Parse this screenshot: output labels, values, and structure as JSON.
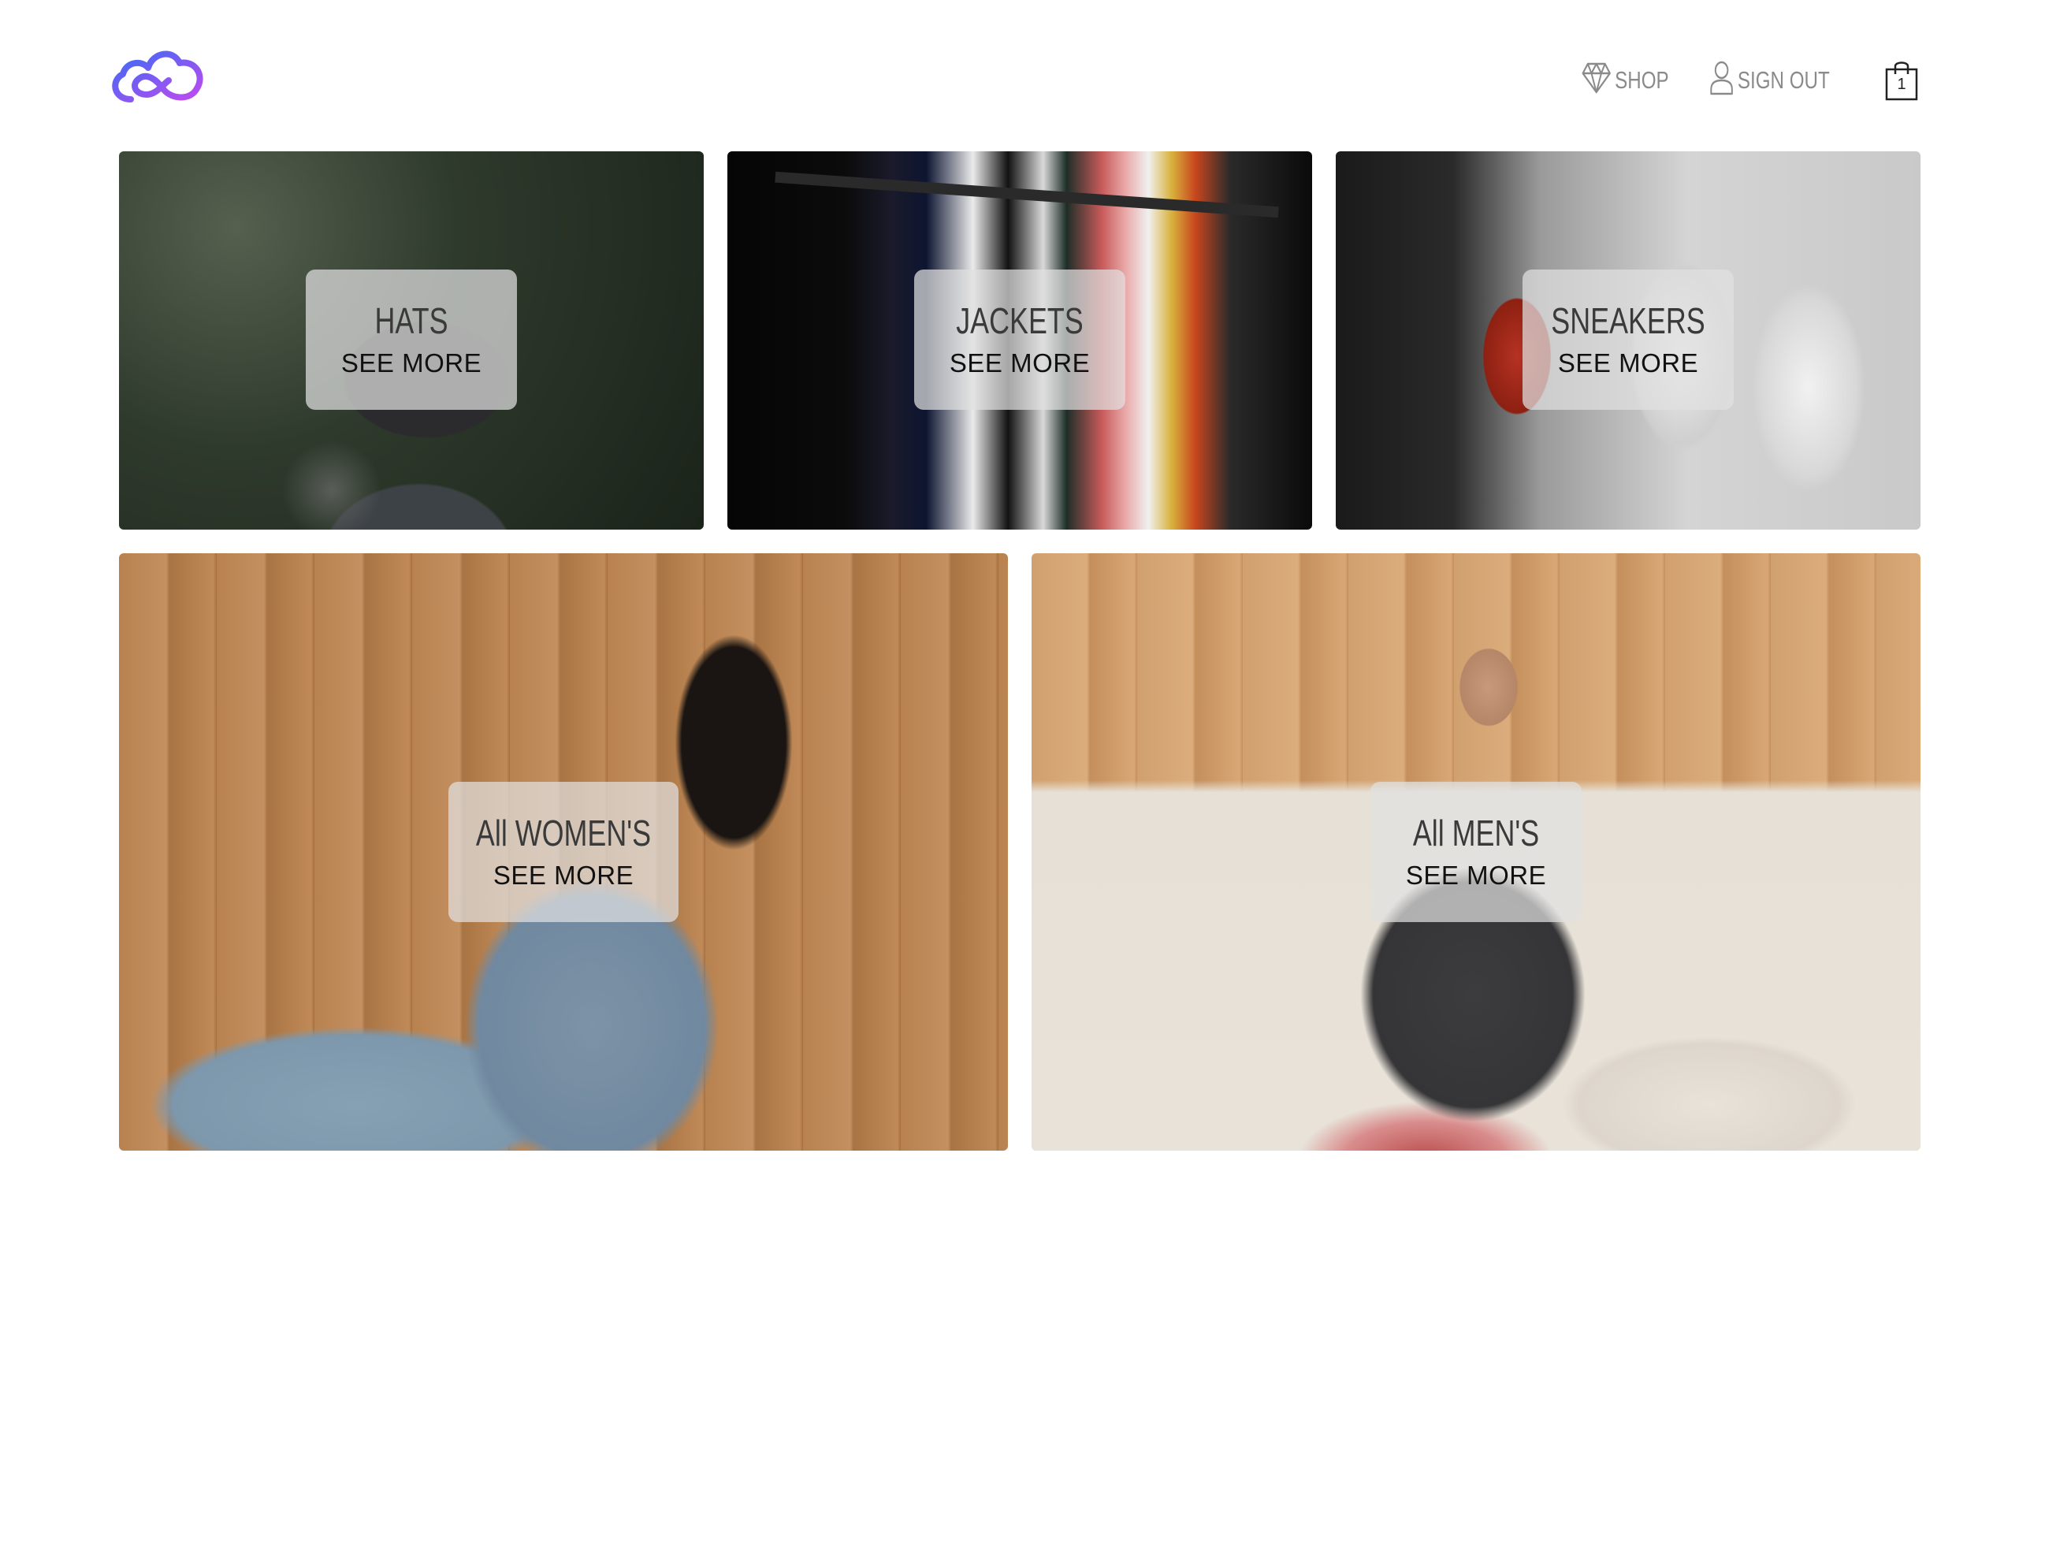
{
  "header": {
    "nav": {
      "shop_label": "SHOP",
      "signout_label": "SIGN OUT"
    },
    "cart": {
      "count": "1"
    }
  },
  "categories": [
    {
      "title": "HATS",
      "cta": "SEE MORE"
    },
    {
      "title": "JACKETS",
      "cta": "SEE MORE"
    },
    {
      "title": "SNEAKERS",
      "cta": "SEE MORE"
    },
    {
      "title": "All WOMEN'S",
      "cta": "SEE MORE"
    },
    {
      "title": "All MEN'S",
      "cta": "SEE MORE"
    }
  ],
  "colors": {
    "logo_gradient_start": "#3b6cf5",
    "logo_gradient_end": "#c04af0",
    "nav_text": "#8a8a8a",
    "label_bg": "rgba(225,225,225,0.72)"
  }
}
